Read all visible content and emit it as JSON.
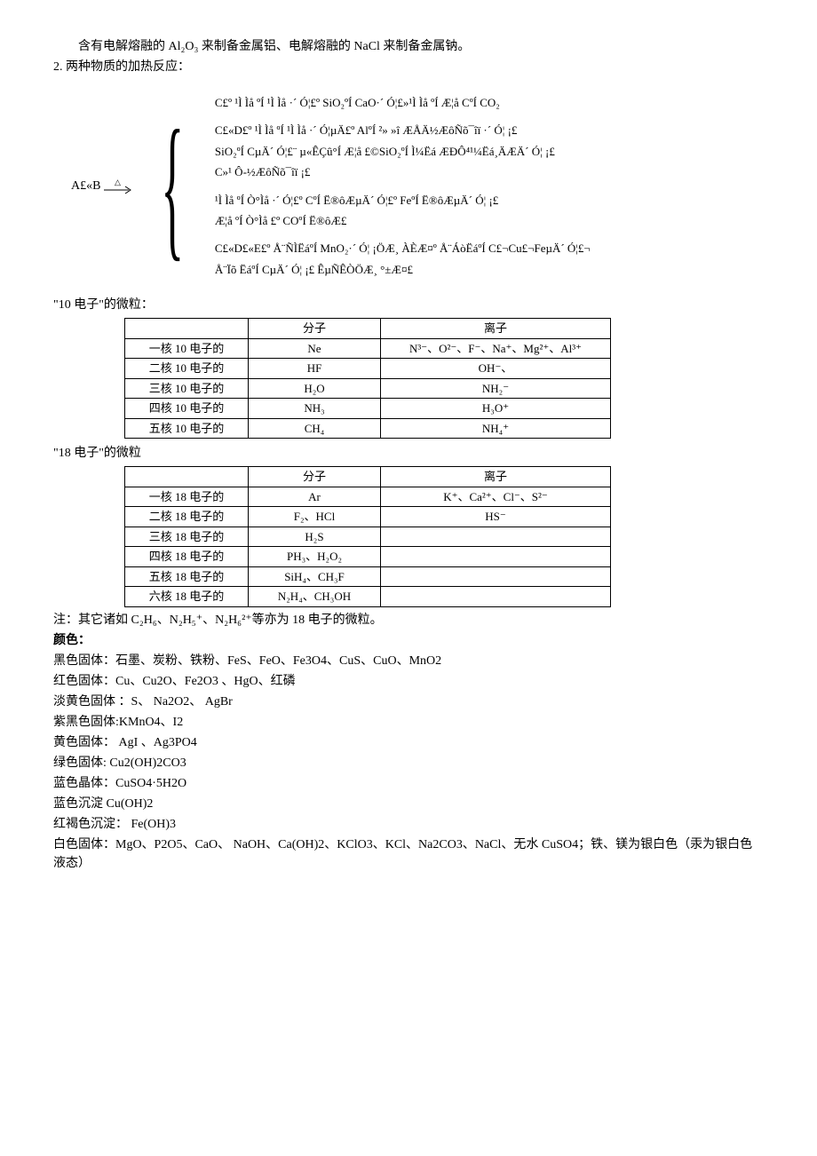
{
  "intro_line": "含有电解熔融的 Al₂O₃ 来制备金属铝、电解熔融的 NaCl 来制备金属钠。",
  "point2_label": "2. 两种物质的加热反应：",
  "reaction": {
    "left": "A£«B",
    "triangle": "△",
    "items": [
      "C£º ¹Ì Ìå ºÍ ¹Ì Ìå ·´ Ó¦£º SiO₂ºÍ CaO·´ Ó¦£»¹Ì Ìå ºÍ Æ¦å CºÍ CO₂",
      "C£«D£º ¹Ì Ìå ºÍ ¹Ì Ìå ·´ Ó¦µÄ£º AlºÍ ²» »î ÆÅÄ½ÆôÑõ¯îï ·´ Ó¦ ¡£\nSiO₂ºÍ CµÄ´ Ó¦£¨ µ«ÊÇû°Í Æ¦å £©SiO₂ºÍ Ì¼Ëá ÆÐÔ⁴¹¼Ëá¸ÄÆÄ´ Ó¦ ¡£\nC»¹ Ô-½ÆôÑõ¯îï  ¡£",
      "¹Ì Ìå ºÍ Ò°Ìå ·´ Ó¦£º CºÍ Ë®ôÆµÄ´ Ó¦£º FeºÍ Ë®ôÆµÄ´ Ó¦ ¡£\nÆ¦å ºÍ Ò°Ìå £º COºÍ Ë®ôÆ£",
      "C£«D£«E£º Å¨ÑÌËáºÍ MnO₂·´ Ó¦ ¡ÖÆ¸ ÀÈÆ¤º Å¨ÁòËáºÍ C£¬Cu£¬FeµÄ´ Ó¦£¬\nÅ¨Ïõ ËáºÍ CµÄ´ Ó¦ ¡£ ÊµÑÊÒÖÆ¸ °±Æ¤£"
    ]
  },
  "t10_label": "\"10 电子\"的微粒：",
  "t10": {
    "headers": [
      "",
      "分子",
      "离子"
    ],
    "rows": [
      [
        "一核 10 电子的",
        "Ne",
        "N³⁻、O²⁻、F⁻、Na⁺、Mg²⁺、Al³⁺"
      ],
      [
        "二核 10 电子的",
        "HF",
        "OH⁻、"
      ],
      [
        "三核 10 电子的",
        "H₂O",
        "NH₂⁻"
      ],
      [
        "四核 10 电子的",
        "NH₃",
        "H₃O⁺"
      ],
      [
        "五核 10 电子的",
        "CH₄",
        "NH₄⁺"
      ]
    ]
  },
  "t18_label": "\"18 电子\"的微粒",
  "t18": {
    "headers": [
      "",
      "分子",
      "离子"
    ],
    "rows": [
      [
        "一核 18 电子的",
        "Ar",
        "K⁺、Ca²⁺、Cl⁻、S²⁻"
      ],
      [
        "二核 18 电子的",
        "F₂、HCl",
        "HS⁻"
      ],
      [
        "三核 18 电子的",
        "H₂S",
        ""
      ],
      [
        "四核 18 电子的",
        "PH₃、H₂O₂",
        ""
      ],
      [
        "五核 18 电子的",
        "SiH₄、CH₃F",
        ""
      ],
      [
        "六核 18 电子的",
        "N₂H₄、CH₃OH",
        ""
      ]
    ]
  },
  "t18_note": "注：其它诸如 C₂H₆、N₂H₅⁺、N₂H₆²⁺等亦为 18 电子的微粒。",
  "colors_label": "颜色：",
  "color_lines": [
    "黑色固体：石墨、炭粉、铁粉、FeS、FeO、Fe3O4、CuS、CuO、MnO2",
    "红色固体：Cu、Cu2O、Fe2O3 、HgO、红磷",
    "淡黄色固体 ：S、 Na2O2、 AgBr",
    "紫黑色固体:KMnO4、I2",
    "黄色固体：  AgI 、Ag3PO4",
    "绿色固体: Cu2(OH)2CO3",
    "蓝色晶体：CuSO4·5H2O",
    "蓝色沉淀 Cu(OH)2",
    "红褐色沉淀：  Fe(OH)3",
    "白色固体：MgO、P2O5、CaO、 NaOH、Ca(OH)2、KClO3、KCl、Na2CO3、NaCl、无水 CuSO4；铁、镁为银白色（汞为银白色液态）"
  ]
}
